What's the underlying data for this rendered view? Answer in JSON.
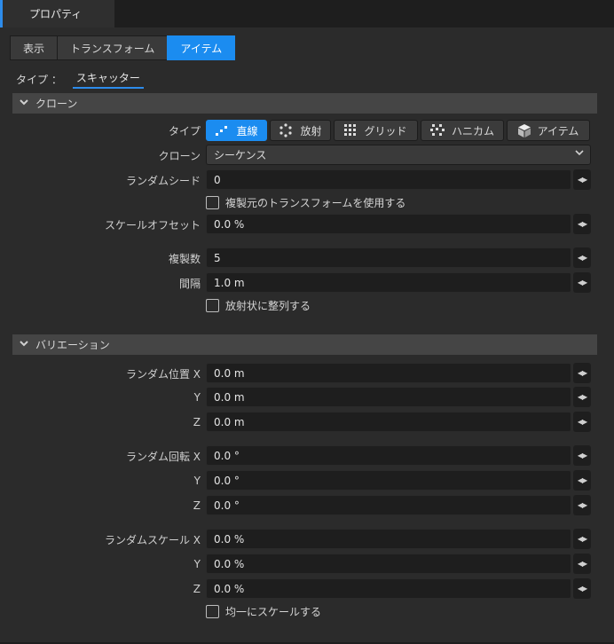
{
  "panel": {
    "title": "プロパティ"
  },
  "tabs": [
    "表示",
    "トランスフォーム",
    "アイテム"
  ],
  "type_row": {
    "label": "タイプ ：",
    "value": "スキャッター"
  },
  "clone_section": {
    "title": "クローン",
    "type_label": "タイプ",
    "modes": [
      "直線",
      "放射",
      "グリッド",
      "ハニカム",
      "アイテム"
    ],
    "clone_label": "クローン",
    "clone_value": "シーケンス",
    "seed_label": "ランダムシード",
    "seed_value": "0",
    "use_source_transform": "複製元のトランスフォームを使用する",
    "scale_offset_label": "スケールオフセット",
    "scale_offset_value": "0.0 %",
    "count_label": "複製数",
    "count_value": "5",
    "spacing_label": "間隔",
    "spacing_value": "1.0 m",
    "radial_align": "放射状に整列する"
  },
  "variation_section": {
    "title": "バリエーション",
    "pos_x_label": "ランダム位置 X",
    "pos_x": "0.0 m",
    "pos_y_label": "Y",
    "pos_y": "0.0 m",
    "pos_z_label": "Z",
    "pos_z": "0.0 m",
    "rot_x_label": "ランダム回転 X",
    "rot_x": "0.0 °",
    "rot_y_label": "Y",
    "rot_y": "0.0 °",
    "rot_z_label": "Z",
    "rot_z": "0.0 °",
    "scale_x_label": "ランダムスケール X",
    "scale_x": "0.0 %",
    "scale_y_label": "Y",
    "scale_y": "0.0 %",
    "scale_z_label": "Z",
    "scale_z": "0.0 %",
    "uniform_scale": "均一にスケールする"
  },
  "colors": {
    "accent": "#1b8cf0",
    "bg": "#2b2b2b",
    "field": "#1e1e1e"
  },
  "icons": {
    "spin": "spin-arrows-icon",
    "section": "chevron-down-icon",
    "dropdown": "chevron-down-icon"
  }
}
